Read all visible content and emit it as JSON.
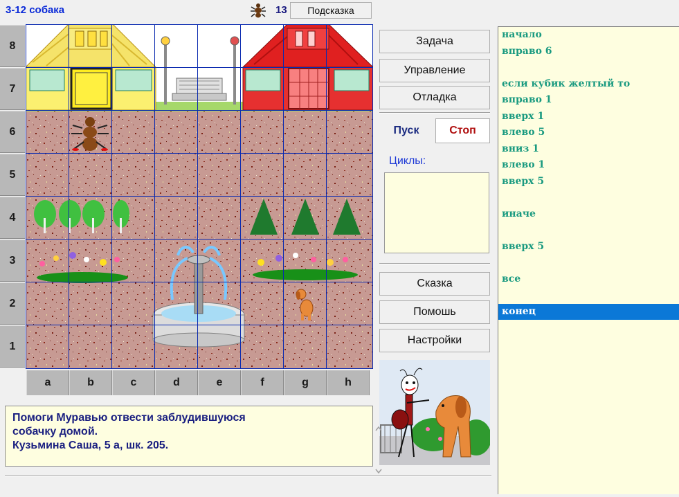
{
  "header": {
    "title": "3-12 собака",
    "count": "13",
    "hint_label": "Подсказка"
  },
  "board": {
    "rows": [
      "8",
      "7",
      "6",
      "5",
      "4",
      "3",
      "2",
      "1"
    ],
    "cols": [
      "a",
      "b",
      "c",
      "d",
      "e",
      "f",
      "g",
      "h"
    ]
  },
  "buttons": {
    "task": "Задача",
    "control": "Управление",
    "debug": "Отладка",
    "run": "Пуск",
    "stop": "Стоп",
    "cycles": "Циклы:",
    "tale": "Сказка",
    "help": "Помошь",
    "settings": "Настройки"
  },
  "message": {
    "line1": "Помоги Муравью отвести заблудившуюся",
    "line2": "собачку домой.",
    "line3": "Кузьмина Саша, 5 а, шк. 205."
  },
  "program": {
    "lines": [
      {
        "text": "начало",
        "color": "#1a9a80"
      },
      {
        "text": "вправо 6",
        "color": "#1a9a80"
      },
      {
        "text": "",
        "color": "#1a9a80"
      },
      {
        "text": "если кубик желтый то",
        "color": "#1a9a80"
      },
      {
        "text": "вправо 1",
        "color": "#1a9a80"
      },
      {
        "text": "вверх 1",
        "color": "#1a9a80"
      },
      {
        "text": "влево 5",
        "color": "#1a9a80"
      },
      {
        "text": "вниз 1",
        "color": "#1a9a80"
      },
      {
        "text": "влево 1",
        "color": "#1a9a80"
      },
      {
        "text": "вверх 5",
        "color": "#1a9a80"
      },
      {
        "text": "",
        "color": "#1a9a80"
      },
      {
        "text": "иначе",
        "color": "#1a9a80"
      },
      {
        "text": "",
        "color": "#1a9a80"
      },
      {
        "text": "вверх 5",
        "color": "#1a9a80"
      },
      {
        "text": "",
        "color": "#1a9a80"
      },
      {
        "text": "все",
        "color": "#1a9a80"
      },
      {
        "text": "",
        "color": "#1a9a80"
      },
      {
        "text": "конец",
        "color": "#ffffff",
        "selected": true
      }
    ]
  },
  "colors": {
    "accent": "#0b78d7",
    "title": "#0a2ad8",
    "stop": "#b01010"
  }
}
